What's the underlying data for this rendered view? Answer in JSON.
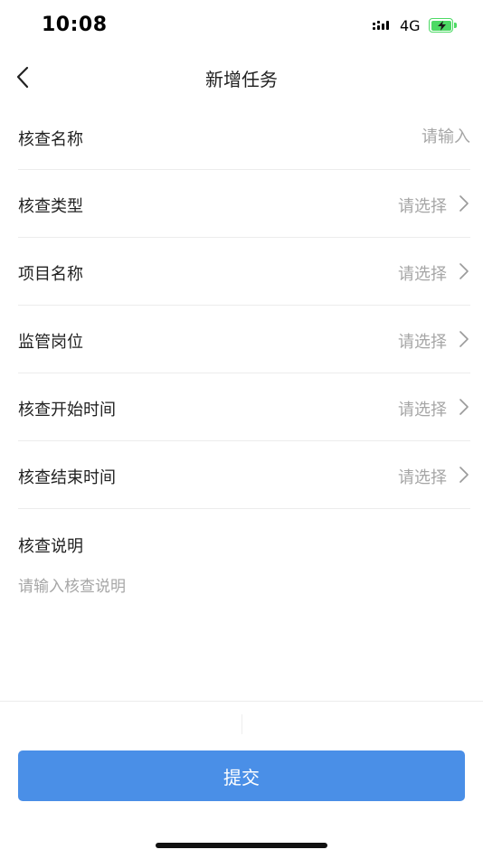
{
  "status_bar": {
    "time": "10:08",
    "network": "4G",
    "battery_color": "#4cd964"
  },
  "nav": {
    "title": "新增任务",
    "back_icon": "chevron-left-icon"
  },
  "form": {
    "name": {
      "label": "核查名称",
      "placeholder": "请输入"
    },
    "type": {
      "label": "核查类型",
      "value": "请选择"
    },
    "project": {
      "label": "项目名称",
      "value": "请选择"
    },
    "post": {
      "label": "监管岗位",
      "value": "请选择"
    },
    "start_time": {
      "label": "核查开始时间",
      "value": "请选择"
    },
    "end_time": {
      "label": "核查结束时间",
      "value": "请选择"
    },
    "description": {
      "label": "核查说明",
      "placeholder": "请输入核查说明"
    }
  },
  "submit": {
    "label": "提交",
    "color": "#4a8fe7"
  }
}
